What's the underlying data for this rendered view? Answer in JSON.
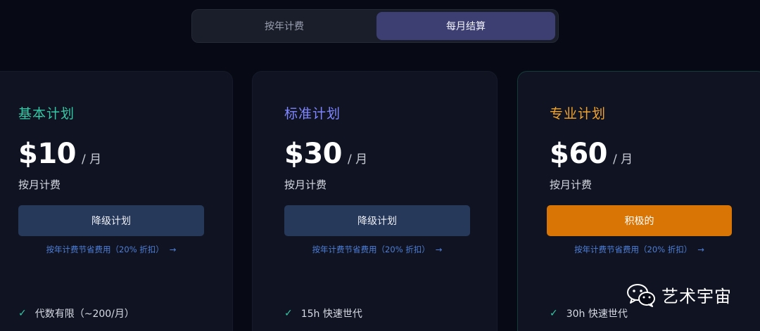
{
  "billing_toggle": {
    "yearly_label": "按年计费",
    "monthly_label": "每月结算",
    "selected": "monthly"
  },
  "plans": [
    {
      "name": "基本计划",
      "price": "$10",
      "per": "/ 月",
      "billing_note": "按月计费",
      "button_label": "降级计划",
      "save_link": "按年计费节省费用（20% 折扣）",
      "feature": "代数有限（~200/月）"
    },
    {
      "name": "标准计划",
      "price": "$30",
      "per": "/ 月",
      "billing_note": "按月计费",
      "button_label": "降级计划",
      "save_link": "按年计费节省费用（20% 折扣）",
      "feature": "15h 快速世代"
    },
    {
      "name": "专业计划",
      "price": "$60",
      "per": "/ 月",
      "billing_note": "按月计费",
      "button_label": "积极的",
      "save_link": "按年计费节省费用（20% 折扣）",
      "feature": "30h 快速世代"
    }
  ],
  "icons": {
    "arrow": "→",
    "check": "✓"
  },
  "watermark": {
    "text": "艺术宇宙",
    "icon": "wechat-icon"
  },
  "colors": {
    "basic_accent": "#35c8a6",
    "standard_accent": "#7f86ff",
    "pro_accent": "#f3a42c",
    "active_button": "#d97504",
    "toggle_selected": "#3d3f73"
  }
}
